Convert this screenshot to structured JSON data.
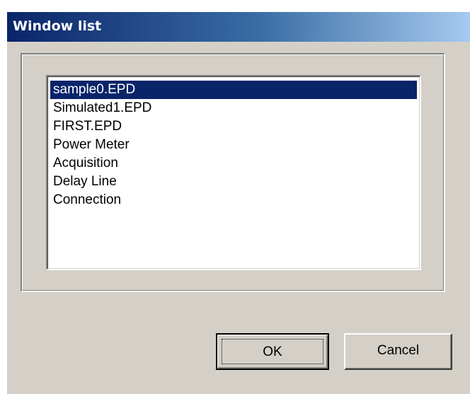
{
  "window": {
    "title": "Window list"
  },
  "list": {
    "items": [
      {
        "label": "sample0.EPD",
        "selected": true
      },
      {
        "label": "Simulated1.EPD",
        "selected": false
      },
      {
        "label": "FIRST.EPD",
        "selected": false
      },
      {
        "label": "Power Meter",
        "selected": false
      },
      {
        "label": "Acquisition",
        "selected": false
      },
      {
        "label": "Delay Line",
        "selected": false
      },
      {
        "label": "Connection",
        "selected": false
      }
    ]
  },
  "buttons": {
    "ok_label": "OK",
    "cancel_label": "Cancel"
  },
  "colors": {
    "selection": "#0a246a",
    "dialog_face": "#d4d0c8",
    "titlebar_start": "#0a246a",
    "titlebar_end": "#a6caf0"
  }
}
